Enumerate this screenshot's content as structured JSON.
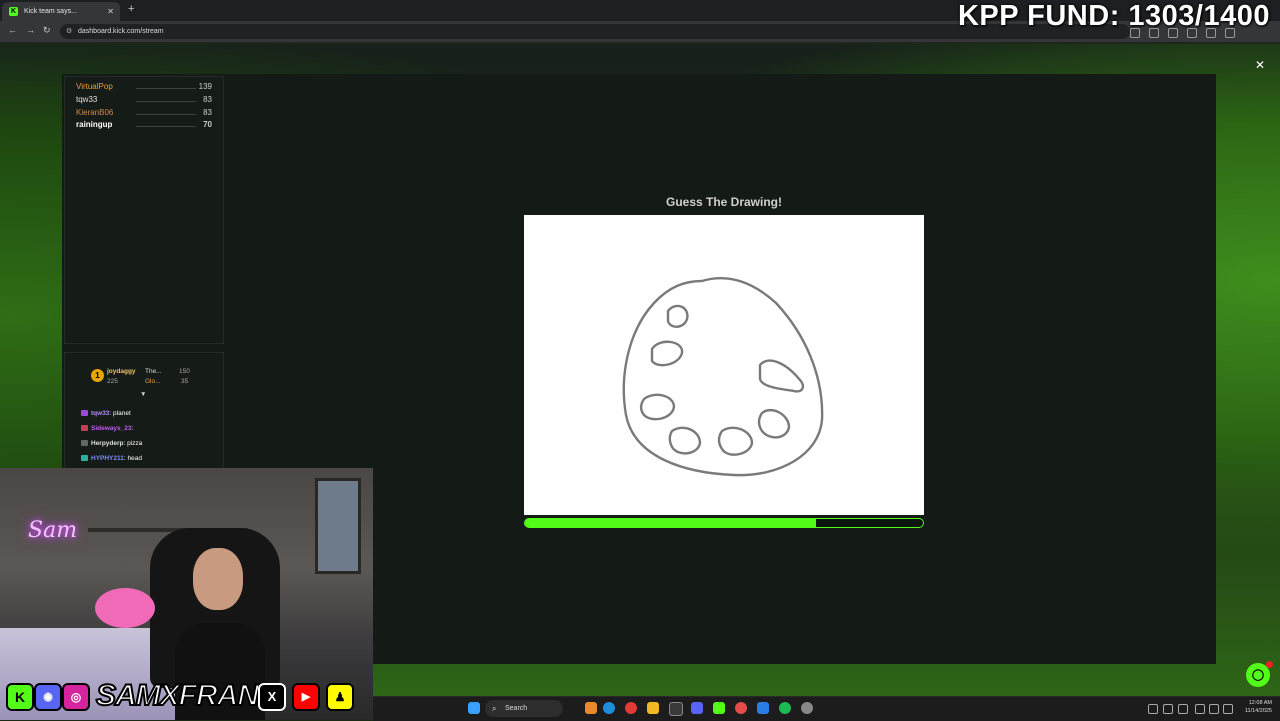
{
  "browser": {
    "tab_title": "Kick team says...",
    "tab_icon": "kick-icon",
    "url": "dashboard.kick.com/stream"
  },
  "overlay": {
    "fund_text": "KPP FUND: 1303/1400"
  },
  "leaderboard": [
    {
      "name": "VirtualPop",
      "score": "139",
      "color": "#e8a03a"
    },
    {
      "name": "tqw33",
      "score": "83",
      "color": "#e0e0e0"
    },
    {
      "name": "KieranB06",
      "score": "83",
      "color": "#d08a4a"
    },
    {
      "name": "rainingup",
      "score": "70",
      "color": "#ffffff"
    }
  ],
  "chat": {
    "pinned": {
      "rank": "1",
      "user1": "joydaggy",
      "user1_count": "225",
      "user2": "The...",
      "user2_count": "150",
      "user3": "Glo...",
      "user3_count": "35"
    },
    "messages": [
      {
        "user": "tqw33",
        "text": ": planet",
        "color": "#b78cff"
      },
      {
        "user": "Sideways_23",
        "text": ":",
        "color": "#c45cf2"
      },
      {
        "user": "Herpyderp",
        "text": ": pizza",
        "color": "#e0e0e0"
      },
      {
        "user": "HYPHY211",
        "text": ": head",
        "color": "#7c8cff"
      }
    ]
  },
  "game": {
    "title": "Guess The Drawing!",
    "timer_fraction": 0.73
  },
  "stream": {
    "neon_sign": "Sam",
    "handle": "SAMXFRANK"
  },
  "taskbar": {
    "search_label": "Search",
    "time": "12:08 AM",
    "date": "11/14/2025"
  },
  "colors": {
    "kick_green": "#53fc18"
  }
}
